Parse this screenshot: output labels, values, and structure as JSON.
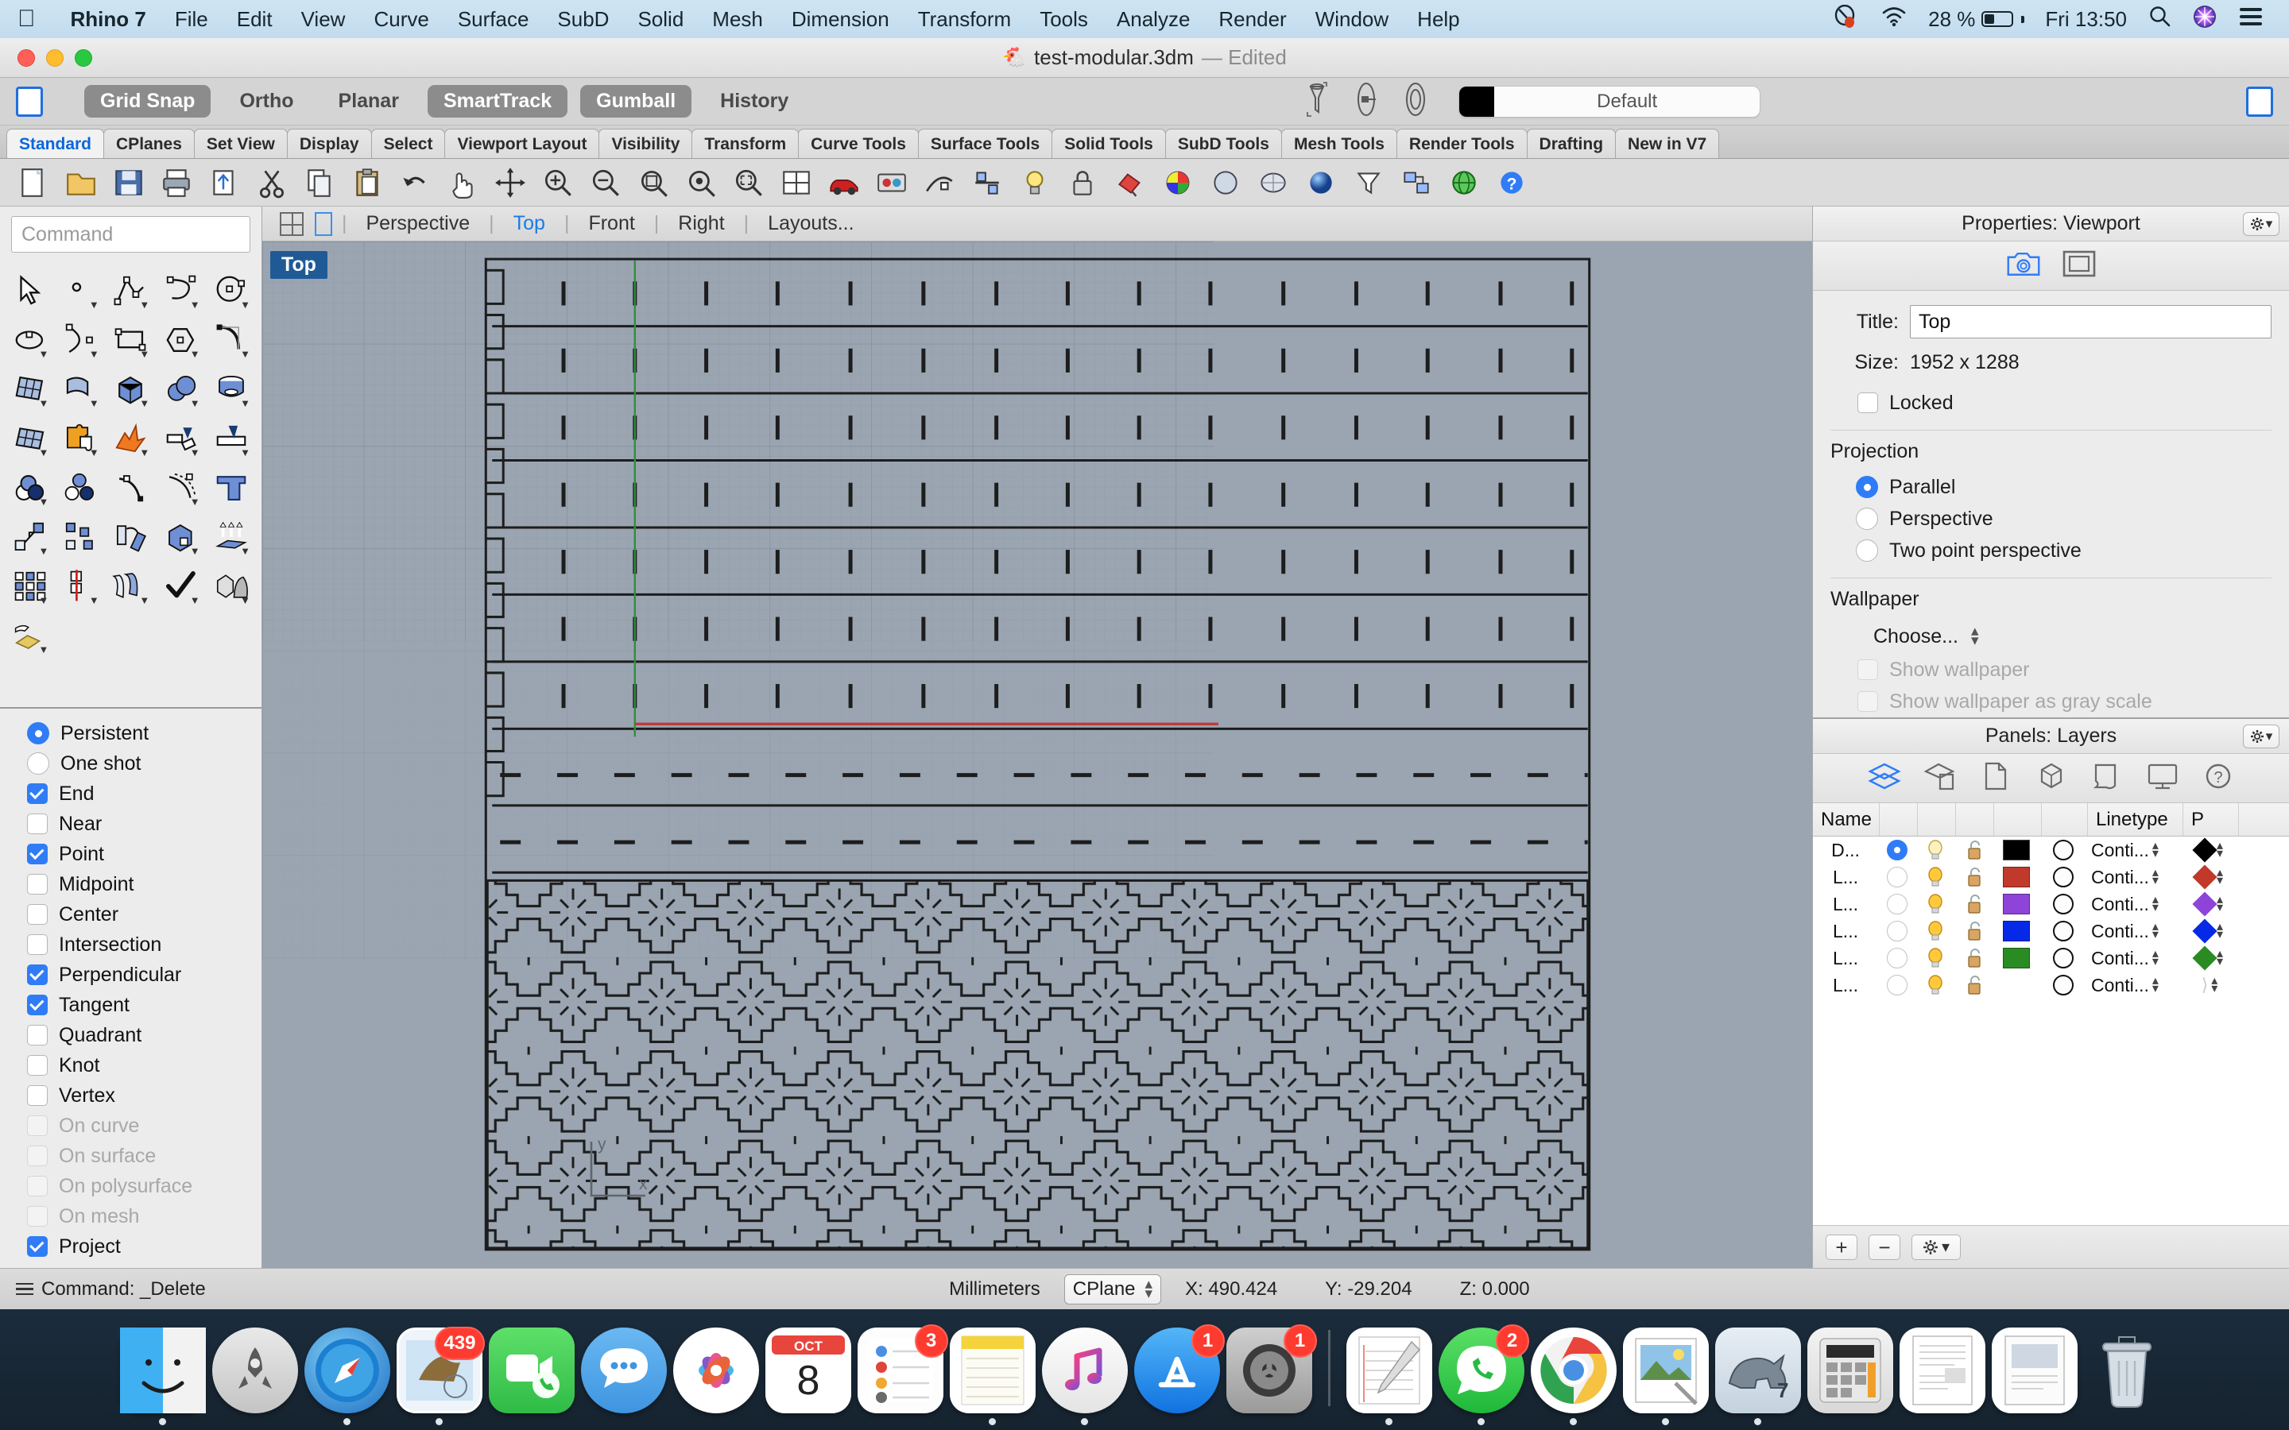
{
  "menubar": {
    "apple": "apple-logo",
    "items": [
      "Rhino 7",
      "File",
      "Edit",
      "View",
      "Curve",
      "Surface",
      "SubD",
      "Solid",
      "Mesh",
      "Dimension",
      "Transform",
      "Tools",
      "Analyze",
      "Render",
      "Window",
      "Help"
    ],
    "battery_percent": "28 %",
    "clock": "Fri 13:50"
  },
  "window": {
    "title": "test-modular.3dm",
    "edited": "— Edited"
  },
  "optionbar": {
    "toggles": [
      {
        "label": "Grid Snap",
        "on": true
      },
      {
        "label": "Ortho",
        "on": false
      },
      {
        "label": "Planar",
        "on": false
      },
      {
        "label": "SmartTrack",
        "on": true
      },
      {
        "label": "Gumball",
        "on": true
      },
      {
        "label": "History",
        "on": false
      }
    ],
    "material": {
      "name": "Default",
      "color": "#000000"
    }
  },
  "toolbar_tabs": {
    "active": "Standard",
    "items": [
      "Standard",
      "CPlanes",
      "Set View",
      "Display",
      "Select",
      "Viewport Layout",
      "Visibility",
      "Transform",
      "Curve Tools",
      "Surface Tools",
      "Solid Tools",
      "SubD Tools",
      "Mesh Tools",
      "Render Tools",
      "Drafting",
      "New in V7"
    ]
  },
  "command": {
    "placeholder": "Command"
  },
  "osnap": {
    "items": [
      {
        "label": "Persistent",
        "type": "radio",
        "checked": true,
        "enabled": true
      },
      {
        "label": "One shot",
        "type": "radio",
        "checked": false,
        "enabled": true
      },
      {
        "label": "End",
        "type": "check",
        "checked": true,
        "enabled": true
      },
      {
        "label": "Near",
        "type": "check",
        "checked": false,
        "enabled": true
      },
      {
        "label": "Point",
        "type": "check",
        "checked": true,
        "enabled": true
      },
      {
        "label": "Midpoint",
        "type": "check",
        "checked": false,
        "enabled": true
      },
      {
        "label": "Center",
        "type": "check",
        "checked": false,
        "enabled": true
      },
      {
        "label": "Intersection",
        "type": "check",
        "checked": false,
        "enabled": true
      },
      {
        "label": "Perpendicular",
        "type": "check",
        "checked": true,
        "enabled": true
      },
      {
        "label": "Tangent",
        "type": "check",
        "checked": true,
        "enabled": true
      },
      {
        "label": "Quadrant",
        "type": "check",
        "checked": false,
        "enabled": true
      },
      {
        "label": "Knot",
        "type": "check",
        "checked": false,
        "enabled": true
      },
      {
        "label": "Vertex",
        "type": "check",
        "checked": false,
        "enabled": true
      },
      {
        "label": "On curve",
        "type": "check",
        "checked": false,
        "enabled": false
      },
      {
        "label": "On surface",
        "type": "check",
        "checked": false,
        "enabled": false
      },
      {
        "label": "On polysurface",
        "type": "check",
        "checked": false,
        "enabled": false
      },
      {
        "label": "On mesh",
        "type": "check",
        "checked": false,
        "enabled": false
      },
      {
        "label": "Project",
        "type": "check",
        "checked": true,
        "enabled": true
      }
    ]
  },
  "viewport_tabs": {
    "active": "Top",
    "items": [
      "Perspective",
      "Top",
      "Front",
      "Right",
      "Layouts..."
    ]
  },
  "viewport": {
    "label": "Top",
    "axis_x": "x",
    "axis_y": "y",
    "background": "#9aa5b1"
  },
  "properties": {
    "header": "Properties: Viewport",
    "title_label": "Title:",
    "title_value": "Top",
    "size_label": "Size:",
    "size_value": "1952 x 1288",
    "locked_label": "Locked",
    "locked_checked": false,
    "projection_title": "Projection",
    "projection_options": [
      {
        "label": "Parallel",
        "checked": true
      },
      {
        "label": "Perspective",
        "checked": false
      },
      {
        "label": "Two point perspective",
        "checked": false
      }
    ],
    "wallpaper_title": "Wallpaper",
    "wallpaper_choose": "Choose...",
    "wallpaper_checks": [
      {
        "label": "Show wallpaper",
        "checked": false,
        "enabled": false
      },
      {
        "label": "Show wallpaper as gray scale",
        "checked": false,
        "enabled": false
      }
    ]
  },
  "layers": {
    "header": "Panels: Layers",
    "columns": [
      "Name",
      "",
      "",
      "",
      "",
      "Linetype",
      "P"
    ],
    "rows": [
      {
        "name": "D...",
        "current": true,
        "on": true,
        "locked": false,
        "color": "#000000",
        "linetype": "Conti...",
        "print": "#000000"
      },
      {
        "name": "L...",
        "current": false,
        "on": true,
        "locked": false,
        "color": "#c0392b",
        "linetype": "Conti...",
        "print": "#c0392b"
      },
      {
        "name": "L...",
        "current": false,
        "on": true,
        "locked": false,
        "color": "#8e44d8",
        "linetype": "Conti...",
        "print": "#8e44d8"
      },
      {
        "name": "L...",
        "current": false,
        "on": true,
        "locked": false,
        "color": "#0629e8",
        "linetype": "Conti...",
        "print": "#0629e8"
      },
      {
        "name": "L...",
        "current": false,
        "on": true,
        "locked": false,
        "color": "#2a8b23",
        "linetype": "Conti...",
        "print": "#2a8b23"
      },
      {
        "name": "L...",
        "current": false,
        "on": true,
        "locked": false,
        "color": "",
        "linetype": "Conti...",
        "print": ""
      }
    ]
  },
  "statusbar": {
    "command": "Command: _Delete",
    "units": "Millimeters",
    "cplane": "CPlane",
    "x": "X: 490.424",
    "y": "Y: -29.204",
    "z": "Z: 0.000"
  },
  "dock": {
    "items": [
      {
        "name": "finder",
        "badge": "",
        "running": true
      },
      {
        "name": "launchpad",
        "badge": "",
        "running": false
      },
      {
        "name": "safari",
        "badge": "",
        "running": true
      },
      {
        "name": "mail",
        "badge": "439",
        "running": true
      },
      {
        "name": "facetime",
        "badge": "",
        "running": false
      },
      {
        "name": "messages",
        "badge": "",
        "running": false
      },
      {
        "name": "photos",
        "badge": "",
        "running": false
      },
      {
        "name": "calendar",
        "badge": "",
        "running": false
      },
      {
        "name": "reminders",
        "badge": "3",
        "running": false
      },
      {
        "name": "notes",
        "badge": "",
        "running": true
      },
      {
        "name": "music",
        "badge": "",
        "running": true
      },
      {
        "name": "app-store",
        "badge": "1",
        "running": false
      },
      {
        "name": "system-preferences",
        "badge": "1",
        "running": false
      },
      {
        "name": "textedit",
        "badge": "",
        "running": true
      },
      {
        "name": "whatsapp",
        "badge": "2",
        "running": true
      },
      {
        "name": "chrome",
        "badge": "",
        "running": true
      },
      {
        "name": "preview",
        "badge": "",
        "running": true
      },
      {
        "name": "rhino",
        "badge": "",
        "running": true
      },
      {
        "name": "calculator",
        "badge": "",
        "running": false
      },
      {
        "name": "document-1",
        "badge": "",
        "running": false
      },
      {
        "name": "document-2",
        "badge": "",
        "running": false
      },
      {
        "name": "trash",
        "badge": "",
        "running": false
      }
    ]
  }
}
